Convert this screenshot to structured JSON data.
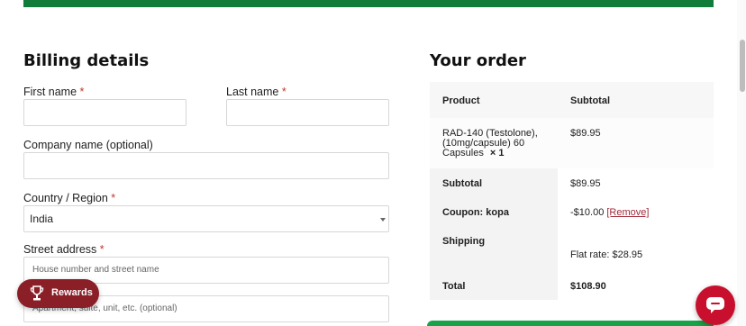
{
  "billing": {
    "title": "Billing details",
    "first_name_label": "First name",
    "last_name_label": "Last name",
    "company_label": "Company name (optional)",
    "country_label": "Country / Region",
    "country_value": "India",
    "street_label": "Street address",
    "street_placeholder": "House number and street name",
    "apartment_placeholder": "Apartment, suite, unit, etc. (optional)",
    "required_mark": "*"
  },
  "order": {
    "title": "Your order",
    "header_product": "Product",
    "header_subtotal": "Subtotal",
    "item_name_line1": "RAD-140 (Testolone),",
    "item_name_line2": "(10mg/capsule) 60",
    "item_name_line3": "Capsules",
    "item_qty": "× 1",
    "item_price": "$89.95",
    "subtotal_label": "Subtotal",
    "subtotal_value": "$89.95",
    "coupon_label": "Coupon: kopa",
    "coupon_value": "-$10.00",
    "coupon_remove": "[Remove]",
    "shipping_label": "Shipping",
    "shipping_value": "Flat rate: $28.95",
    "total_label": "Total",
    "total_value": "$108.90"
  },
  "widgets": {
    "rewards_label": "Rewards"
  },
  "colors": {
    "brand_green": "#127d3a",
    "rewards_red": "#8a1f28",
    "chat_red": "#c8102e"
  }
}
